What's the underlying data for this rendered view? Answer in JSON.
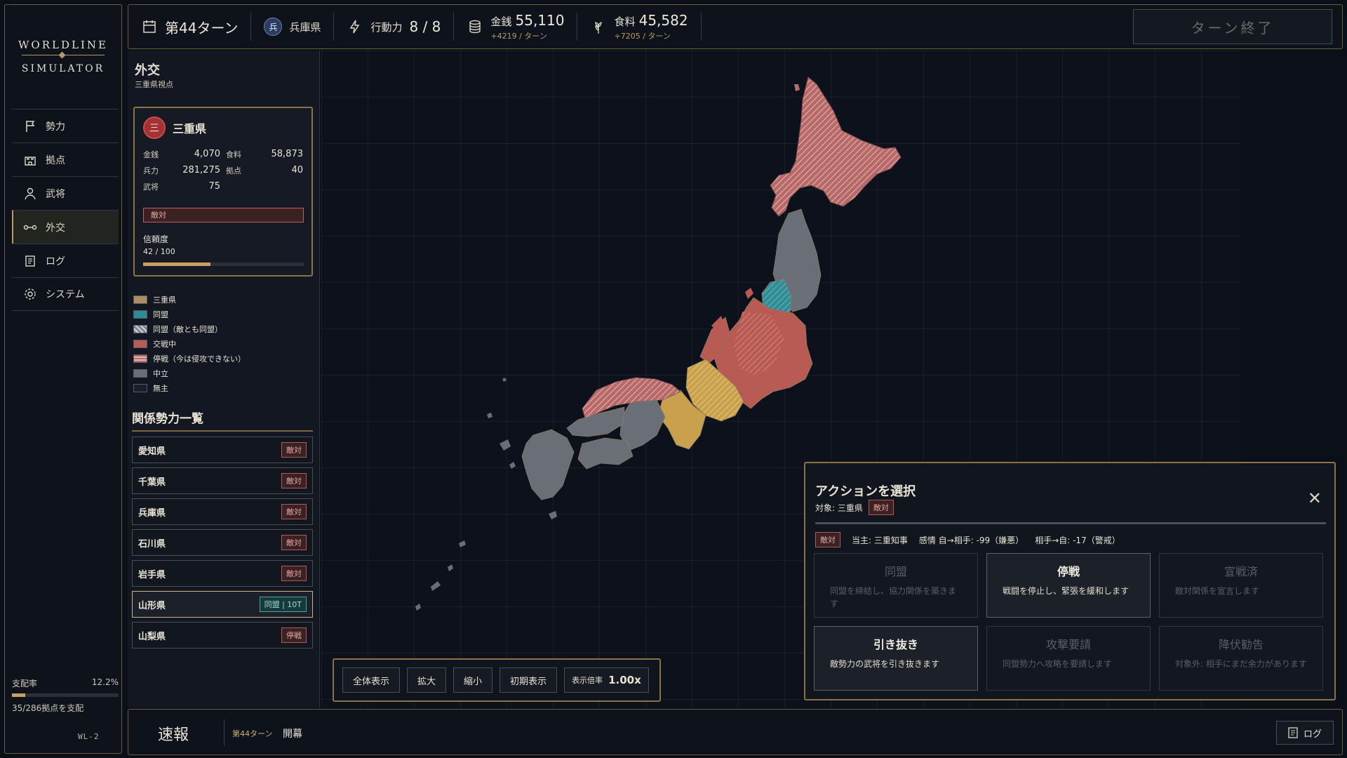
{
  "app": {
    "logo_line1": "WORLDLINE",
    "logo_line2": "SIMULATOR",
    "version": "WL-2"
  },
  "nav": {
    "items": [
      {
        "label": "勢力",
        "icon": "flag-icon"
      },
      {
        "label": "拠点",
        "icon": "castle-icon"
      },
      {
        "label": "武将",
        "icon": "person-icon"
      },
      {
        "label": "外交",
        "icon": "link-icon",
        "active": true
      },
      {
        "label": "ログ",
        "icon": "document-icon"
      },
      {
        "label": "システム",
        "icon": "gear-icon"
      }
    ]
  },
  "dominance": {
    "label": "支配率",
    "percent": "12.2%",
    "fraction": 0.122,
    "summary": "35/286拠点を支配"
  },
  "topbar": {
    "turn": "第44ターン",
    "faction": "兵庫県",
    "faction_crest": "兵",
    "action_label": "行動力",
    "action_value": "8 / 8",
    "money_label": "金銭",
    "money_value": "55,110",
    "money_delta": "+4219 / ターン",
    "food_label": "食料",
    "food_value": "45,582",
    "food_delta": "+7205 / ターン",
    "end_turn": "ターン終了"
  },
  "diplomacy": {
    "title": "外交",
    "subtitle": "三重県視点",
    "card": {
      "emblem": "三",
      "name": "三重県",
      "money_k": "金銭",
      "money_v": "4,070",
      "food_k": "食料",
      "food_v": "58,873",
      "troops_k": "兵力",
      "troops_v": "281,275",
      "bases_k": "拠点",
      "bases_v": "40",
      "generals_k": "武将",
      "generals_v": "75",
      "relation": "敵対",
      "trust_label": "信頼度",
      "trust_value": "42 / 100",
      "trust_fraction": 0.42
    },
    "legend": [
      {
        "label": "三重県",
        "color": "#b08d5e"
      },
      {
        "label": "同盟",
        "color": "#2f8c95"
      },
      {
        "label": "同盟（敵とも同盟）",
        "color": "#7e8388"
      },
      {
        "label": "交戦中",
        "color": "#b85b55"
      },
      {
        "label": "停戦（今は侵攻できない）",
        "color": "#b86a6a"
      },
      {
        "label": "中立",
        "color": "#6a6e77"
      },
      {
        "label": "無主",
        "color": "#1a1f29"
      }
    ],
    "relations_title": "関係勢力一覧",
    "relations": [
      {
        "name": "愛知県",
        "status": "敵対"
      },
      {
        "name": "千葉県",
        "status": "敵対"
      },
      {
        "name": "兵庫県",
        "status": "敵対"
      },
      {
        "name": "石川県",
        "status": "敵対"
      },
      {
        "name": "岩手県",
        "status": "敵対"
      },
      {
        "name": "山形県",
        "status": "同盟 | 10T"
      },
      {
        "name": "山梨県",
        "status": "停戦"
      }
    ]
  },
  "zoom": {
    "fit": "全体表示",
    "zoom_in": "拡大",
    "zoom_out": "縮小",
    "reset": "初期表示",
    "scale_label": "表示倍率",
    "scale_value": "1.00x"
  },
  "action": {
    "title": "アクションを選択",
    "target": "対象: 三重県",
    "target_badge": "敵対",
    "info_badge": "敵対",
    "ruler": "当主: 三重知事",
    "emotion": "感情 自→相手: -99（嫌悪）",
    "reverse": "相手→自: -17（警戒）",
    "buttons": [
      {
        "title": "同盟",
        "desc": "同盟を締結し、協力関係を築きます",
        "enabled": false
      },
      {
        "title": "停戦",
        "desc": "戦闘を停止し、緊張を緩和します",
        "enabled": true
      },
      {
        "title": "宣戦済",
        "desc": "敵対関係を宣言します",
        "enabled": false
      },
      {
        "title": "引き抜き",
        "desc": "敵勢力の武将を引き抜きます",
        "enabled": true
      },
      {
        "title": "攻撃要請",
        "desc": "同盟勢力へ攻略を要請します",
        "enabled": false
      },
      {
        "title": "降伏勧告",
        "desc": "対象外: 相手にまだ余力があります",
        "enabled": false
      }
    ]
  },
  "news": {
    "label": "速報",
    "turn": "第44ターン",
    "message": "開幕",
    "log": "ログ"
  }
}
